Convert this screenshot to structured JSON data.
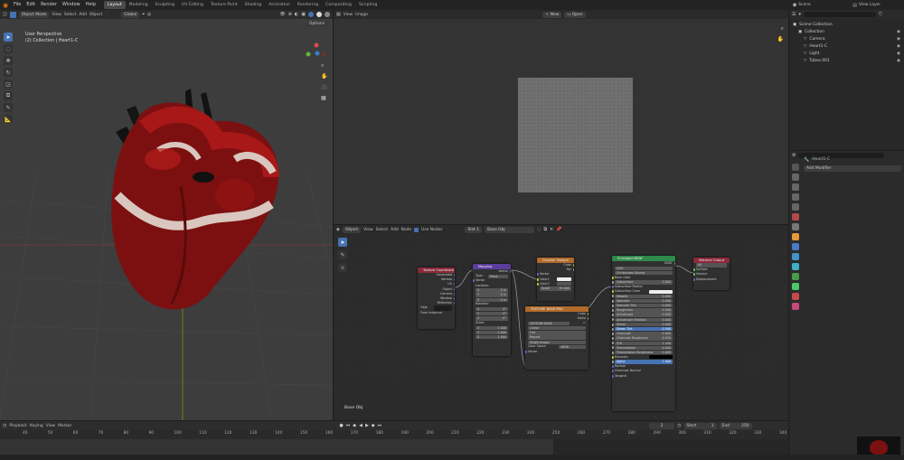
{
  "topbar": {
    "menus": [
      "File",
      "Edit",
      "Render",
      "Window",
      "Help"
    ],
    "workspaces": [
      "Layout",
      "Modeling",
      "Sculpting",
      "UV Editing",
      "Texture Paint",
      "Shading",
      "Animation",
      "Rendering",
      "Compositing",
      "Scripting"
    ],
    "active_workspace": "Layout",
    "scene_label": "Scene",
    "view_layer_label": "View Layer"
  },
  "viewport": {
    "mode": "Object Mode",
    "menus": [
      "View",
      "Select",
      "Add",
      "Object"
    ],
    "orientation": "Global",
    "options_label": "Options",
    "overlay_title": "User Perspective",
    "overlay_subtitle": "(2) Collection | Heart1-C"
  },
  "image_editor": {
    "menus": [
      "View",
      "Image"
    ],
    "new_label": "New",
    "open_label": "Open"
  },
  "node_editor": {
    "object_label": "Object",
    "menus": [
      "View",
      "Select",
      "Add",
      "Node"
    ],
    "use_nodes_label": "Use Nodes",
    "slot_label": "Slot 1",
    "material_name": "Base Obj",
    "footer_label": "Base Obj",
    "nodes": {
      "texcoord": {
        "title": "Texture Coordinate",
        "outputs": [
          "Generated",
          "Normal",
          "UV",
          "Object",
          "Camera",
          "Window",
          "Reflection"
        ],
        "object_label": "Obje",
        "from_instancer": "From Instancer"
      },
      "mapping": {
        "title": "Mapping",
        "output": "Vector",
        "type_label": "Type:",
        "type_value": "Point",
        "vector_label": "Vector",
        "location_label": "Location:",
        "location": [
          [
            "X",
            "0 m"
          ],
          [
            "Y",
            "0 m"
          ],
          [
            "Z",
            "0 m"
          ]
        ],
        "rotation_label": "Rotation:",
        "rotation": [
          [
            "X",
            "0°"
          ],
          [
            "Y",
            "0°"
          ],
          [
            "Z",
            "0°"
          ]
        ],
        "scale_label": "Scale:",
        "scale": [
          [
            "X",
            "1.000"
          ],
          [
            "Y",
            "1.000"
          ],
          [
            "Z",
            "1.000"
          ]
        ]
      },
      "checker": {
        "title": "Checker Texture",
        "outputs": [
          "Color",
          "Fac"
        ],
        "inputs": [
          "Vector",
          "Color1",
          "Color2"
        ],
        "scale_label": "Scale",
        "scale_value": "99.000"
      },
      "image_tex": {
        "title": "TEXTURE BASE.PNG",
        "outputs": [
          "Color",
          "Alpha"
        ],
        "image_name": "TEXTURE BASE",
        "interpolation": "Linear",
        "projection": "Flat",
        "extension": "Repeat",
        "source": "Single Image",
        "color_space_label": "Color Space",
        "color_space_value": "sRGB",
        "vector_label": "Vector"
      },
      "principled": {
        "title": "Principled BSDF",
        "output": "BSDF",
        "distribution": "GGX",
        "subsurface_method": "Christensen-Burley",
        "rows": [
          [
            "Base Color",
            ""
          ],
          [
            "Subsurface",
            "0.000"
          ],
          [
            "Subsurface Radius",
            ""
          ],
          [
            "Subsurface Color",
            ""
          ],
          [
            "Metallic",
            "0.000"
          ],
          [
            "Specular",
            "0.500"
          ],
          [
            "Specular Tint",
            "0.000"
          ],
          [
            "Roughness",
            "0.500"
          ],
          [
            "Anisotropic",
            "0.000"
          ],
          [
            "Anisotropic Rotation",
            "0.000"
          ],
          [
            "Sheen",
            "0.000"
          ],
          [
            "Sheen Tint",
            "0.500"
          ],
          [
            "Clearcoat",
            "0.000"
          ],
          [
            "Clearcoat Roughness",
            "0.030"
          ],
          [
            "IOR",
            "1.450"
          ],
          [
            "Transmission",
            "0.000"
          ],
          [
            "Transmission Roughness",
            "0.000"
          ],
          [
            "Emission",
            ""
          ],
          [
            "Alpha",
            "1.000"
          ],
          [
            "Normal",
            ""
          ],
          [
            "Clearcoat Normal",
            ""
          ],
          [
            "Tangent",
            ""
          ]
        ]
      },
      "output": {
        "title": "Material Output",
        "target": "All",
        "inputs": [
          "Surface",
          "Volume",
          "Displacement"
        ]
      }
    }
  },
  "timeline": {
    "menus": [
      "Playback",
      "Keying",
      "View",
      "Marker"
    ],
    "current_frame": "2",
    "start_label": "Start",
    "start_value": "1",
    "end_label": "End",
    "end_value": "250",
    "ticks": [
      "40",
      "50",
      "60",
      "70",
      "80",
      "90",
      "100",
      "110",
      "120",
      "130",
      "140",
      "150",
      "160",
      "170",
      "180",
      "190",
      "200",
      "210",
      "220",
      "230",
      "240",
      "250",
      "260",
      "270",
      "280",
      "290",
      "300",
      "310",
      "320",
      "330",
      "340"
    ]
  },
  "outliner": {
    "scene_collection": "Scene Collection",
    "items": [
      {
        "name": "Collection",
        "level": 1,
        "color": "#d0d0d0"
      },
      {
        "name": "Camera",
        "level": 2,
        "color": "#e8a06a"
      },
      {
        "name": "Heart1-C",
        "level": 2,
        "color": "#e8a06a"
      },
      {
        "name": "Light",
        "level": 2,
        "color": "#e8a06a"
      },
      {
        "name": "Tubes.001",
        "level": 2,
        "color": "#e8a06a"
      }
    ]
  },
  "properties": {
    "object_name": "Heart1-C",
    "add_modifier_label": "Add Modifier"
  },
  "colors": {
    "accent": "#4772b3",
    "texcoord_header": "#8b2a3a",
    "mapping_header": "#5c3d9e",
    "texture_header": "#b06a2a",
    "shader_header": "#2e8a4a",
    "output_header": "#8b2a3a"
  }
}
